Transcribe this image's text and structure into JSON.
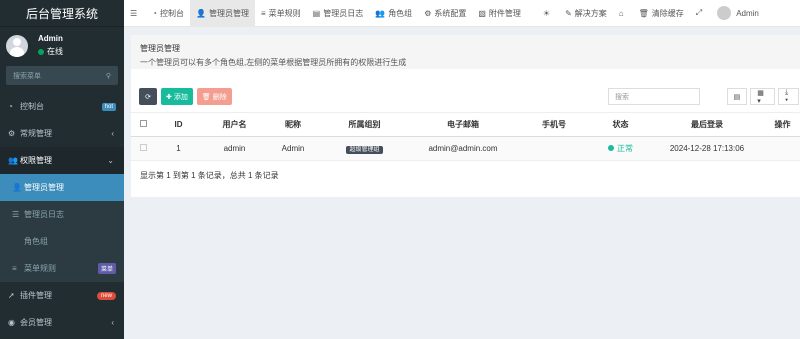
{
  "app": {
    "title": "后台管理系统"
  },
  "user": {
    "name": "Admin",
    "status": "在线"
  },
  "sidebar": {
    "search_placeholder": "搜索菜单",
    "items": [
      {
        "label": "控制台",
        "badge": "hot"
      },
      {
        "label": "常规管理"
      },
      {
        "label": "权限管理"
      },
      {
        "label": "管理员管理"
      },
      {
        "label": "管理员日志"
      },
      {
        "label": "角色组"
      },
      {
        "label": "菜单规则",
        "badge": "菜单"
      },
      {
        "label": "插件管理",
        "badge": "new"
      },
      {
        "label": "会员管理"
      }
    ]
  },
  "topbar": {
    "tabs": [
      "控制台",
      "管理员管理",
      "菜单规则",
      "管理员日志",
      "角色组",
      "系统配置",
      "附件管理"
    ],
    "solution": "解决方案",
    "clear_cache": "清除缓存",
    "user": "Admin"
  },
  "page": {
    "title": "管理员管理",
    "desc": "一个管理员可以有多个角色组,左侧的菜单根据管理员所拥有的权限进行生成",
    "add_label": "添加",
    "delete_label": "删除",
    "search_placeholder": "搜索",
    "footer": "显示第 1 到第 1 条记录，总共 1 条记录"
  },
  "table": {
    "headers": [
      "ID",
      "用户名",
      "昵称",
      "所属组别",
      "电子邮箱",
      "手机号",
      "状态",
      "最后登录",
      "操作"
    ],
    "rows": [
      {
        "id": "1",
        "username": "admin",
        "nickname": "Admin",
        "group": "超级管理组",
        "email": "admin@admin.com",
        "mobile": "",
        "status": "正常",
        "last_login": "2024-12-28 17:13:06"
      }
    ]
  },
  "colors": {
    "accent": "#3c8dbc",
    "success": "#18bc9c",
    "danger": "#f49e92",
    "sidebar_bg": "#222d32"
  },
  "icons": [
    "dashboard-icon",
    "list-icon",
    "user-icon",
    "refresh-icon",
    "plus-icon",
    "trash-icon",
    "home-icon",
    "expand-icon",
    "search-icon"
  ]
}
